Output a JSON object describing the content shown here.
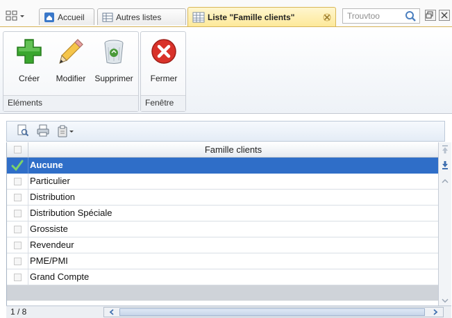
{
  "tabs": [
    {
      "label": "Accueil",
      "icon": "home-icon"
    },
    {
      "label": "Autres listes",
      "icon": "list-icon"
    },
    {
      "label": "Liste \"Famille clients\"",
      "icon": "grid-icon",
      "active": true
    }
  ],
  "search": {
    "placeholder": "Trouvtoo",
    "icon": "search-icon"
  },
  "ribbon": {
    "groups": [
      {
        "label": "Eléments",
        "buttons": [
          {
            "label": "Créer",
            "icon": "add-icon",
            "color": "#3aa62e"
          },
          {
            "label": "Modifier",
            "icon": "pencil-icon",
            "color": "#f0b43a"
          },
          {
            "label": "Supprimer",
            "icon": "trash-icon",
            "color": "#4a9a3a"
          }
        ]
      },
      {
        "label": "Fenêtre",
        "buttons": [
          {
            "label": "Fermer",
            "icon": "close-circle-icon",
            "color": "#d9322a"
          }
        ]
      }
    ]
  },
  "grid": {
    "column_header": "Famille clients",
    "rows": [
      {
        "label": "Aucune",
        "selected": true
      },
      {
        "label": "Particulier"
      },
      {
        "label": "Distribution"
      },
      {
        "label": "Distribution Spéciale"
      },
      {
        "label": "Grossiste"
      },
      {
        "label": "Revendeur"
      },
      {
        "label": "PME/PMI"
      },
      {
        "label": "Grand Compte"
      }
    ]
  },
  "status": {
    "record_count": "1 / 8"
  },
  "colors": {
    "selection": "#2f6ec8",
    "active_tab": "#fde99a",
    "accent_border": "#d6b356"
  }
}
